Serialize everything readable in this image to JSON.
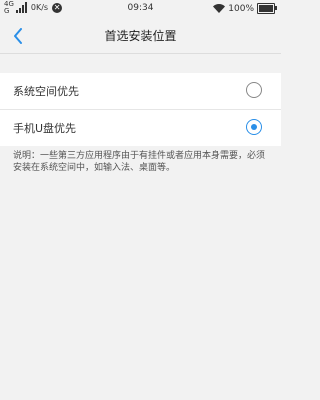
{
  "status_bar": {
    "network_top": "4G",
    "network_bottom": "G",
    "speed": "0K/s",
    "time": "09:34",
    "battery": "100%"
  },
  "header": {
    "title": "首选安装位置"
  },
  "options": [
    {
      "label": "系统空间优先",
      "selected": false
    },
    {
      "label": "手机U盘优先",
      "selected": true
    }
  ],
  "note": "说明：一些第三方应用程序由于有挂件或者应用本身需要，必须安装在系统空间中，如输入法、桌面等。",
  "colors": {
    "accent": "#2a8fe8",
    "background": "#f2f2f2"
  }
}
